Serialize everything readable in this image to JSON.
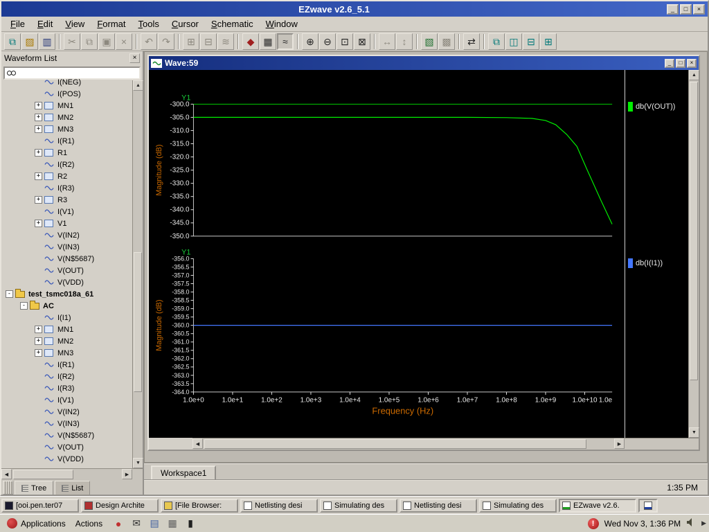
{
  "titlebar": {
    "title": "EZwave  v2.6_5.1"
  },
  "menubar": {
    "items": [
      "File",
      "Edit",
      "View",
      "Format",
      "Tools",
      "Cursor",
      "Schematic",
      "Window"
    ]
  },
  "ui": {
    "glyph_up": "▲",
    "glyph_down": "▼",
    "glyph_left": "◀",
    "glyph_right": "▶",
    "glyph_minimize": "_",
    "glyph_maximize": "□",
    "glyph_close": "×",
    "glyph_alert": "!"
  },
  "toolbar": {
    "items": [
      {
        "name": "new-waveform-window",
        "glyph": "⧉",
        "color": "#007878"
      },
      {
        "name": "open-database",
        "glyph": "▨",
        "color": "#a87800"
      },
      {
        "name": "save",
        "glyph": "▥",
        "color": "#283878"
      },
      {
        "name": "cut",
        "glyph": "✂",
        "disabled": true,
        "sep": true
      },
      {
        "name": "copy",
        "glyph": "⧉",
        "disabled": true
      },
      {
        "name": "paste",
        "glyph": "▣",
        "disabled": true
      },
      {
        "name": "delete",
        "glyph": "×",
        "disabled": true
      },
      {
        "name": "undo",
        "glyph": "↶",
        "disabled": true,
        "sep": true
      },
      {
        "name": "redo",
        "glyph": "↷",
        "disabled": true
      },
      {
        "name": "new-graph",
        "glyph": "⊞",
        "disabled": true,
        "sep": true
      },
      {
        "name": "add-to-graph",
        "glyph": "⊟",
        "disabled": true
      },
      {
        "name": "stack-graphs",
        "glyph": "≋",
        "disabled": true
      },
      {
        "name": "marker",
        "glyph": "◆",
        "color": "#a02020",
        "sep": true
      },
      {
        "name": "table-view",
        "glyph": "▦",
        "color": "#282828"
      },
      {
        "name": "drag-drop-mode",
        "glyph": "≈",
        "color": "#282828",
        "pressed": true
      },
      {
        "name": "zoom-in",
        "glyph": "⊕",
        "sep": true
      },
      {
        "name": "zoom-out",
        "glyph": "⊖"
      },
      {
        "name": "zoom-area",
        "glyph": "⊡"
      },
      {
        "name": "zoom-full",
        "glyph": "⊠"
      },
      {
        "name": "zoom-x",
        "glyph": "↔",
        "disabled": true,
        "sep": true
      },
      {
        "name": "zoom-y",
        "glyph": "↕",
        "disabled": true
      },
      {
        "name": "measurements",
        "glyph": "▧",
        "color": "#207030",
        "sep": true
      },
      {
        "name": "calculator",
        "glyph": "▩",
        "disabled": true
      },
      {
        "name": "cursors",
        "glyph": "⇄",
        "sep": true
      },
      {
        "name": "cascade-windows",
        "glyph": "⧉",
        "color": "#007878",
        "sep": true
      },
      {
        "name": "tile-horizontally",
        "glyph": "◫",
        "color": "#007878"
      },
      {
        "name": "tile-vertically",
        "glyph": "⊟",
        "color": "#007878"
      },
      {
        "name": "open-all-windows",
        "glyph": "⊞",
        "color": "#007878"
      }
    ]
  },
  "waveform_list": {
    "title": "Waveform List",
    "search_value": "",
    "active_tab": "Tree",
    "tabs": [
      {
        "label": "Tree"
      },
      {
        "label": "List"
      }
    ],
    "tree": [
      {
        "label": "I(NEG)",
        "depth": 2,
        "icon": "wave"
      },
      {
        "label": "I(POS)",
        "depth": 2,
        "icon": "wave"
      },
      {
        "label": "MN1",
        "depth": 2,
        "icon": "device",
        "expand": "closed"
      },
      {
        "label": "MN2",
        "depth": 2,
        "icon": "device",
        "expand": "closed"
      },
      {
        "label": "MN3",
        "depth": 2,
        "icon": "device",
        "expand": "closed"
      },
      {
        "label": "I(R1)",
        "depth": 2,
        "icon": "wave"
      },
      {
        "label": "R1",
        "depth": 2,
        "icon": "device",
        "expand": "closed"
      },
      {
        "label": "I(R2)",
        "depth": 2,
        "icon": "wave"
      },
      {
        "label": "R2",
        "depth": 2,
        "icon": "device",
        "expand": "closed"
      },
      {
        "label": "I(R3)",
        "depth": 2,
        "icon": "wave"
      },
      {
        "label": "R3",
        "depth": 2,
        "icon": "device",
        "expand": "closed"
      },
      {
        "label": "I(V1)",
        "depth": 2,
        "icon": "wave"
      },
      {
        "label": "V1",
        "depth": 2,
        "icon": "device",
        "expand": "closed"
      },
      {
        "label": "V(IN2)",
        "depth": 2,
        "icon": "wave"
      },
      {
        "label": "V(IN3)",
        "depth": 2,
        "icon": "wave"
      },
      {
        "label": "V(N$5687)",
        "depth": 2,
        "icon": "wave"
      },
      {
        "label": "V(OUT)",
        "depth": 2,
        "icon": "wave"
      },
      {
        "label": "V(VDD)",
        "depth": 2,
        "icon": "wave"
      },
      {
        "label": "test_tsmc018a_61",
        "depth": 0,
        "icon": "folder",
        "expand": "open",
        "bold": true
      },
      {
        "label": "AC",
        "depth": 1,
        "icon": "folder",
        "expand": "open",
        "bold": true
      },
      {
        "label": "I(I1)",
        "depth": 2,
        "icon": "wave"
      },
      {
        "label": "MN1",
        "depth": 2,
        "icon": "device",
        "expand": "closed"
      },
      {
        "label": "MN2",
        "depth": 2,
        "icon": "device",
        "expand": "closed"
      },
      {
        "label": "MN3",
        "depth": 2,
        "icon": "device",
        "expand": "closed"
      },
      {
        "label": "I(R1)",
        "depth": 2,
        "icon": "wave"
      },
      {
        "label": "I(R2)",
        "depth": 2,
        "icon": "wave"
      },
      {
        "label": "I(R3)",
        "depth": 2,
        "icon": "wave"
      },
      {
        "label": "I(V1)",
        "depth": 2,
        "icon": "wave"
      },
      {
        "label": "V(IN2)",
        "depth": 2,
        "icon": "wave"
      },
      {
        "label": "V(IN3)",
        "depth": 2,
        "icon": "wave"
      },
      {
        "label": "V(N$5687)",
        "depth": 2,
        "icon": "wave"
      },
      {
        "label": "V(OUT)",
        "depth": 2,
        "icon": "wave"
      },
      {
        "label": "V(VDD)",
        "depth": 2,
        "icon": "wave"
      }
    ]
  },
  "wave_window": {
    "title": "Wave:59",
    "legend": [
      {
        "label": "db(V(OUT))",
        "color": "#00ee00"
      },
      {
        "label": "db(I(I1))",
        "color": "#4477ff"
      }
    ]
  },
  "workspace_tab": "Workspace1",
  "status": {
    "clock": "1:35 PM"
  },
  "chart_data": {
    "type": "line",
    "x_scale": "log",
    "xlabel": "Frequency (Hz)",
    "background": "#000000",
    "grid": false,
    "legend_position": "right",
    "xticks": [
      "1.0e+0",
      "1.0e+1",
      "1.0e+2",
      "1.0e+3",
      "1.0e+4",
      "1.0e+5",
      "1.0e+6",
      "1.0e+7",
      "1.0e+8",
      "1.0e+9",
      "1.0e+10"
    ],
    "xtick_partial": "1.0e",
    "x_range_log10": [
      0,
      10.7
    ],
    "plots": [
      {
        "axis_label": "Y1",
        "ylabel": "Magnitude (dB)",
        "ylim": [
          -350,
          -300
        ],
        "ytick_step": 5,
        "yticks": [
          "-300.0",
          "-305.0",
          "-310.0",
          "-315.0",
          "-320.0",
          "-325.0",
          "-330.0",
          "-335.0",
          "-340.0",
          "-345.0",
          "-350.0"
        ],
        "top_line_db": -300,
        "series": [
          {
            "name": "db(V(OUT))",
            "color": "#00ee00",
            "points_log10hz_db": [
              [
                0,
                -305
              ],
              [
                4,
                -305
              ],
              [
                7,
                -305
              ],
              [
                8,
                -305.1
              ],
              [
                8.65,
                -305.4
              ],
              [
                9.0,
                -306.2
              ],
              [
                9.26,
                -307.8
              ],
              [
                9.54,
                -311.5
              ],
              [
                9.8,
                -316
              ],
              [
                10.05,
                -324.5
              ],
              [
                10.4,
                -336
              ],
              [
                10.7,
                -345.5
              ]
            ]
          }
        ]
      },
      {
        "axis_label": "Y1",
        "ylabel": "Magnitude (dB)",
        "ylim": [
          -364,
          -356
        ],
        "ytick_step": 0.5,
        "yticks": [
          "-356.0",
          "-356.5",
          "-357.0",
          "-357.5",
          "-358.0",
          "-358.5",
          "-359.0",
          "-359.5",
          "-360.0",
          "-360.5",
          "-361.0",
          "-361.5",
          "-362.0",
          "-362.5",
          "-363.0",
          "-363.5",
          "-364.0"
        ],
        "series": [
          {
            "name": "db(I(I1))",
            "color": "#4477ff",
            "points_log10hz_db": [
              [
                0,
                -360
              ],
              [
                10.7,
                -360
              ]
            ]
          }
        ]
      }
    ]
  },
  "taskbar": {
    "buttons": [
      {
        "icon": "terminal",
        "label": "[ooi.pen.ter07"
      },
      {
        "icon": "design-architect",
        "label": "Design Archite"
      },
      {
        "icon": "file-browser",
        "label": "[File Browser:"
      },
      {
        "icon": "document",
        "label": "Netlisting desi"
      },
      {
        "icon": "document",
        "label": "Simulating des"
      },
      {
        "icon": "document",
        "label": "Netlisting desi"
      },
      {
        "icon": "document",
        "label": "Simulating des"
      },
      {
        "icon": "ezwave",
        "label": "EZwave  v2.6.",
        "active": true
      },
      {
        "icon": "wave",
        "label": "",
        "active": true,
        "small": true
      }
    ]
  },
  "panel": {
    "menus": [
      {
        "label": "Applications",
        "icon": "redhat"
      },
      {
        "label": "Actions"
      }
    ],
    "launchers": [
      {
        "name": "web-browser",
        "glyph": "●",
        "color": "#c03030"
      },
      {
        "name": "email",
        "glyph": "✉",
        "color": "#303030"
      },
      {
        "name": "file-manager",
        "glyph": "▤",
        "color": "#4060a0"
      },
      {
        "name": "printer",
        "glyph": "▦",
        "color": "#606060"
      },
      {
        "name": "terminal",
        "glyph": "▮",
        "color": "#202020"
      }
    ],
    "clock": "Wed Nov  3,  1:36 PM"
  }
}
